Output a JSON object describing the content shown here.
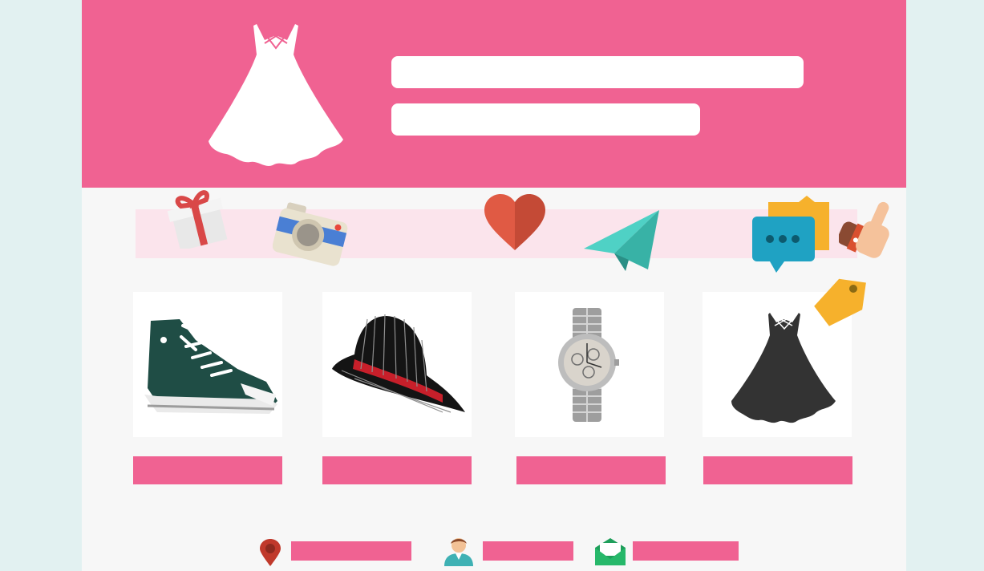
{
  "colors": {
    "brand_pink": "#f06292",
    "strip_pink": "#fbe4ec",
    "background": "#e2f1f1",
    "card": "#ffffff"
  },
  "hero": {
    "logo_icon": "dress-icon",
    "headline": "",
    "subheadline": ""
  },
  "feature_icons": [
    "gift-icon",
    "camera-icon",
    "heart-icon",
    "paper-plane-icon",
    "chat-bubbles-icon",
    "thumbs-up-icon"
  ],
  "products": [
    {
      "icon": "sneaker-icon",
      "button_label": ""
    },
    {
      "icon": "fedora-hat-icon",
      "button_label": ""
    },
    {
      "icon": "wristwatch-icon",
      "button_label": ""
    },
    {
      "icon": "black-dress-icon",
      "button_label": "",
      "tag_icon": "price-tag-icon"
    }
  ],
  "footer": {
    "location": {
      "icon": "map-pin-icon",
      "text": ""
    },
    "account": {
      "icon": "user-icon",
      "text": ""
    },
    "contact": {
      "icon": "envelope-icon",
      "text": ""
    }
  }
}
